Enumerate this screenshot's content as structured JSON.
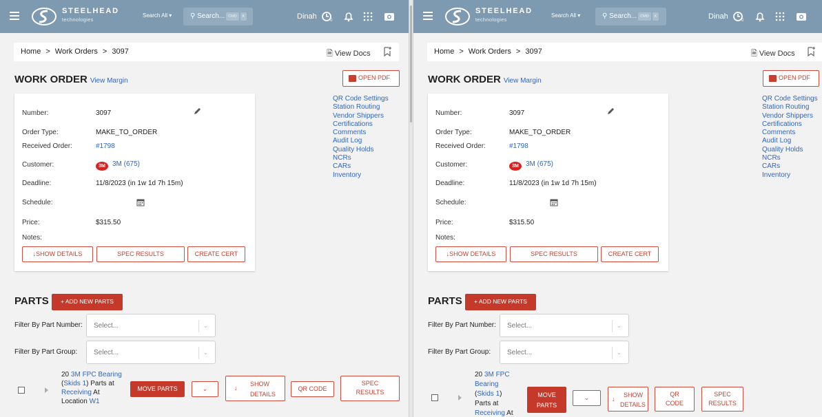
{
  "header": {
    "brand": "STEELHEAD",
    "brand_sub": "technologies",
    "search_scope": "Search All",
    "search_placeholder": "Search...",
    "kbd1": "CMD",
    "kbd2": "K",
    "user": "Dinah",
    "menu_icon": "menu-icon",
    "clock_icon": "clock-icon",
    "bell_icon": "bell-icon",
    "apps_icon": "apps-grid-icon",
    "camera_icon": "camera-icon"
  },
  "breadcrumb": {
    "home": "Home",
    "sep": ">",
    "work_orders": "Work Orders",
    "current": "3097",
    "view_docs": "View Docs"
  },
  "work_order": {
    "title": "WORK ORDER",
    "view_margin": "View Margin",
    "open_pdf": "OPEN PDF",
    "fields": {
      "number_label": "Number:",
      "number": "3097",
      "order_type_label": "Order Type:",
      "order_type": "MAKE_TO_ORDER",
      "received_label": "Received Order:",
      "received": "#1798",
      "customer_label": "Customer:",
      "customer_logo": "3M",
      "customer": "3M (675)",
      "deadline_label": "Deadline:",
      "deadline": "11/8/2023 (in 1w 1d 7h 15m)",
      "schedule_label": "Schedule:",
      "price_label": "Price:",
      "price": "$315.50",
      "notes_label": "Notes:"
    },
    "buttons": {
      "show_details": "SHOW DETAILS",
      "spec_results": "SPEC RESULTS",
      "create_cert": "CREATE CERT"
    },
    "side_links": [
      "QR Code Settings",
      "Station Routing",
      "Vendor Shippers",
      "Certifications",
      "Comments",
      "Audit Log",
      "Quality Holds",
      "NCRs",
      "CARs",
      "Inventory"
    ]
  },
  "parts": {
    "title": "PARTS",
    "add_button": "+ ADD NEW PARTS",
    "filter_number_label": "Filter By Part Number:",
    "filter_group_label": "Filter By Part Group:",
    "select_placeholder": "Select...",
    "row": {
      "qty": "20",
      "part": "3M FPC Bearing",
      "part_a": "3M FPC",
      "part_b": "Bearing",
      "skids_pre": "(",
      "skids": "Skids 1",
      "skids_post": ")",
      "parts_at": "Parts at",
      "parts_word": "Parts",
      "at_word": "at",
      "receiving": "Receiving",
      "at": "At",
      "location": "Location",
      "loc": "W1",
      "move_parts": "MOVE PARTS",
      "move": "MOVE",
      "parts_btn": "PARTS",
      "show_details": "SHOW DETAILS",
      "show": "SHOW",
      "details": "DETAILS",
      "qr_code": "QR CODE",
      "qr": "QR",
      "code": "CODE",
      "spec_results": "SPEC RESULTS",
      "spec": "SPEC",
      "results": "RESULTS"
    }
  }
}
